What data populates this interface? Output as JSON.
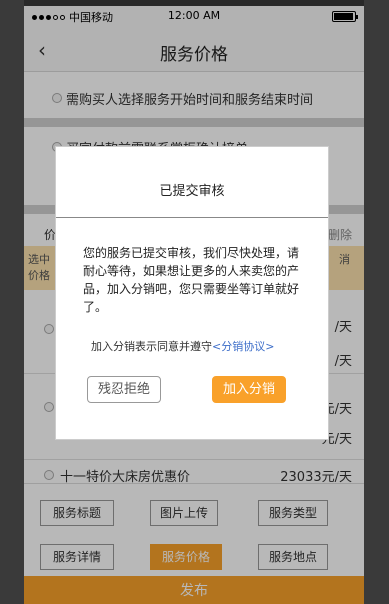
{
  "status_bar": {
    "carrier": "中国移动",
    "time": "12:00 AM"
  },
  "nav": {
    "back_icon": "‹",
    "title": "服务价格"
  },
  "options": [
    {
      "label": "需购买人选择服务开始时间和服务结束时间"
    },
    {
      "label": "买家付款前需联系掌柜确认接单"
    }
  ],
  "list_header": {
    "left": "价",
    "right": "删除"
  },
  "tip": {
    "line1": "选中",
    "line2": "价格",
    "right": "消"
  },
  "rows": [
    {
      "price": "/天"
    },
    {
      "price": "/天"
    },
    {
      "price": "元/天"
    },
    {
      "price": "元/天"
    },
    {
      "name": "十一特价大床房优惠价",
      "price": "23033元/天"
    }
  ],
  "tabs": [
    {
      "label": "服务标题",
      "active": false
    },
    {
      "label": "图片上传",
      "active": false
    },
    {
      "label": "服务类型",
      "active": false
    },
    {
      "label": "服务详情",
      "active": false
    },
    {
      "label": "服务价格",
      "active": true
    },
    {
      "label": "服务地点",
      "active": false
    }
  ],
  "publish_label": "发布",
  "dialog": {
    "title": "已提交审核",
    "message": "您的服务已提交审核，我们尽快处理，请耐心等待，如果想让更多的人来卖您的产品，加入分销吧，您只需要坐等订单就好了。",
    "agree_text": "加入分销表示同意并遵守",
    "agree_link": "<分销协议>",
    "reject_label": "残忍拒绝",
    "join_label": "加入分销"
  },
  "colors": {
    "accent": "#f9a12a",
    "tip_bg": "#fbe1ad",
    "link": "#3d6ec9"
  }
}
